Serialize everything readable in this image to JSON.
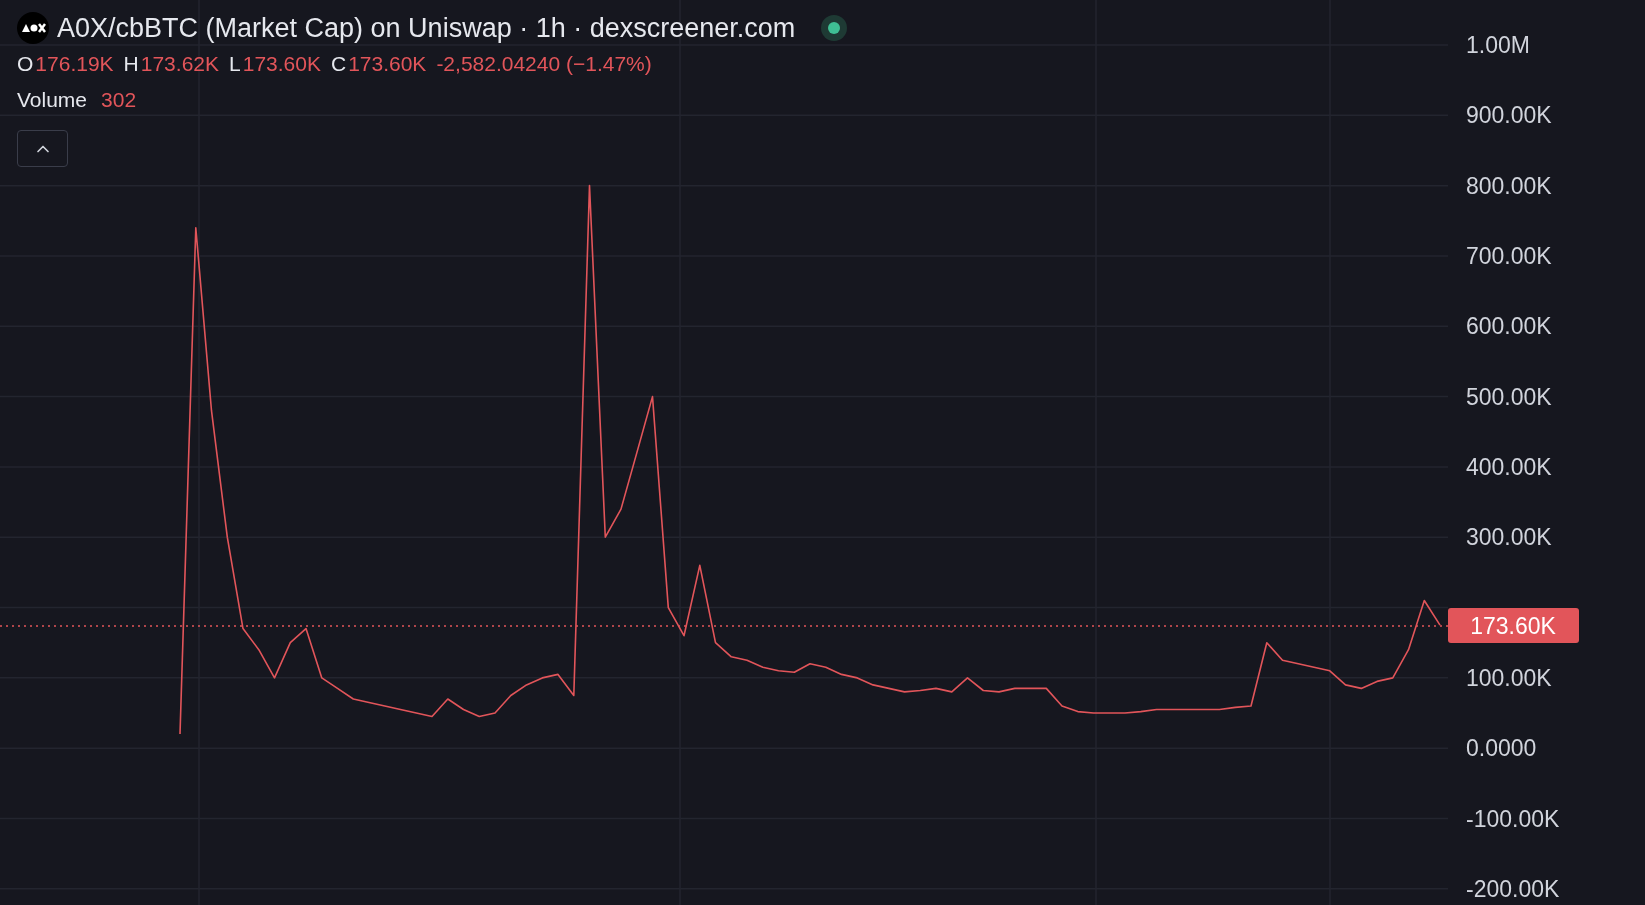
{
  "header": {
    "title": "A0X/cbBTC (Market Cap) on Uniswap · 1h · dexscreener.com",
    "live": true
  },
  "ohlc": [
    {
      "label": "O",
      "value": "176.19K"
    },
    {
      "label": "H",
      "value": "173.62K"
    },
    {
      "label": "L",
      "value": "173.60K"
    },
    {
      "label": "C",
      "value": "173.60K"
    }
  ],
  "change": "-2,582.04240 (−1.47%)",
  "volume": {
    "label": "Volume",
    "value": "302"
  },
  "chart": {
    "chart_data": {
      "type": "line",
      "grid": true,
      "ref_lines": [
        {
          "axis": "y",
          "value": 173600,
          "label": "173.60K",
          "color": "#e2555a"
        }
      ],
      "ylim": [
        -223000,
        1064000
      ],
      "yticks": [
        {
          "value": 1000000,
          "label": "1.00M"
        },
        {
          "value": 900000,
          "label": "900.00K"
        },
        {
          "value": 800000,
          "label": "800.00K"
        },
        {
          "value": 700000,
          "label": "700.00K"
        },
        {
          "value": 600000,
          "label": "600.00K"
        },
        {
          "value": 500000,
          "label": "500.00K"
        },
        {
          "value": 400000,
          "label": "400.00K"
        },
        {
          "value": 300000,
          "label": "300.00K"
        },
        {
          "value": 100000,
          "label": "100.00K"
        },
        {
          "value": 0,
          "label": "0.0000"
        },
        {
          "value": -100000,
          "label": "-100.00K"
        },
        {
          "value": -200000,
          "label": "-200.00K"
        }
      ],
      "categories": [
        null,
        null,
        null,
        null,
        null,
        null,
        null,
        null,
        null,
        null,
        null,
        null,
        null,
        null,
        null,
        null,
        null,
        null,
        null,
        null,
        null,
        null,
        null,
        null,
        null,
        null,
        null,
        null,
        null,
        null,
        null,
        null,
        null,
        null,
        null,
        null,
        null,
        null,
        null,
        null,
        null,
        null,
        null,
        null,
        null,
        null,
        null,
        null,
        null,
        null,
        null,
        null,
        null,
        null,
        null,
        null,
        null,
        null,
        null,
        null,
        null,
        null,
        null,
        null,
        null,
        null,
        null,
        null,
        null,
        null,
        null,
        null,
        null,
        null,
        null,
        null,
        null,
        null,
        null,
        null,
        null
      ],
      "series": [
        {
          "color": "#e2555a",
          "values": [
            20000,
            740000,
            480000,
            300000,
            170000,
            140000,
            100000,
            150000,
            170000,
            100000,
            85000,
            70000,
            65000,
            60000,
            55000,
            50000,
            45000,
            70000,
            55000,
            45000,
            50000,
            75000,
            90000,
            100000,
            105000,
            75000,
            800000,
            300000,
            340000,
            420000,
            500000,
            200000,
            160000,
            260000,
            150000,
            130000,
            125000,
            115000,
            110000,
            108000,
            120000,
            115000,
            105000,
            100000,
            90000,
            85000,
            80000,
            82000,
            85000,
            80000,
            100000,
            82000,
            80000,
            85000,
            85000,
            85000,
            60000,
            52000,
            50000,
            50000,
            50000,
            52000,
            55000,
            55000,
            55000,
            55000,
            55000,
            58000,
            60000,
            150000,
            125000,
            120000,
            115000,
            110000,
            90000,
            85000,
            95000,
            100000,
            140000,
            210000,
            175000
          ]
        }
      ]
    }
  }
}
